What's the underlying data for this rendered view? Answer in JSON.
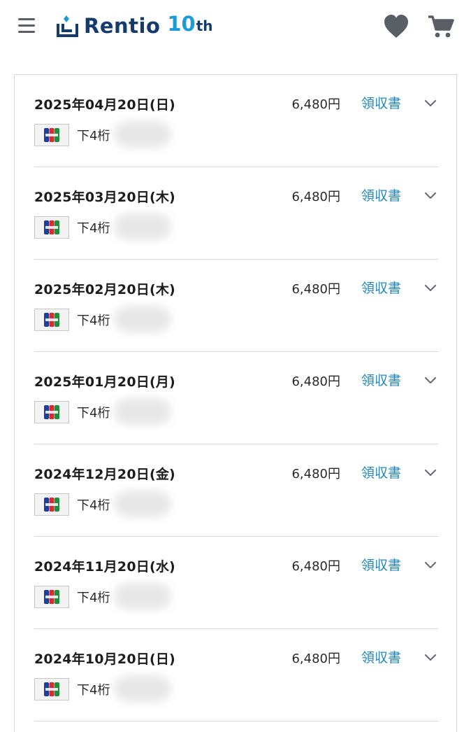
{
  "header": {
    "brand": "Rentio",
    "anniversary_number": "10",
    "anniversary_suffix": "th",
    "icons": {
      "menu": "hamburger-menu-icon",
      "favorites": "heart-icon",
      "cart": "cart-icon"
    }
  },
  "colors": {
    "brand_navy": "#143b6b",
    "brand_blue": "#1c9bd7",
    "link": "#2a86b8",
    "icon_gray": "#5a5f66"
  },
  "payments": [
    {
      "date": "2025年04月20日(日)",
      "amount": "6,480円",
      "receipt": "領収書",
      "card_label": "下4桁",
      "card_brand": "JCB"
    },
    {
      "date": "2025年03月20日(木)",
      "amount": "6,480円",
      "receipt": "領収書",
      "card_label": "下4桁",
      "card_brand": "JCB"
    },
    {
      "date": "2025年02月20日(木)",
      "amount": "6,480円",
      "receipt": "領収書",
      "card_label": "下4桁",
      "card_brand": "JCB"
    },
    {
      "date": "2025年01月20日(月)",
      "amount": "6,480円",
      "receipt": "領収書",
      "card_label": "下4桁",
      "card_brand": "JCB"
    },
    {
      "date": "2024年12月20日(金)",
      "amount": "6,480円",
      "receipt": "領収書",
      "card_label": "下4桁",
      "card_brand": "JCB"
    },
    {
      "date": "2024年11月20日(水)",
      "amount": "6,480円",
      "receipt": "領収書",
      "card_label": "下4桁",
      "card_brand": "JCB"
    },
    {
      "date": "2024年10月20日(日)",
      "amount": "6,480円",
      "receipt": "領収書",
      "card_label": "下4桁",
      "card_brand": "JCB"
    }
  ]
}
